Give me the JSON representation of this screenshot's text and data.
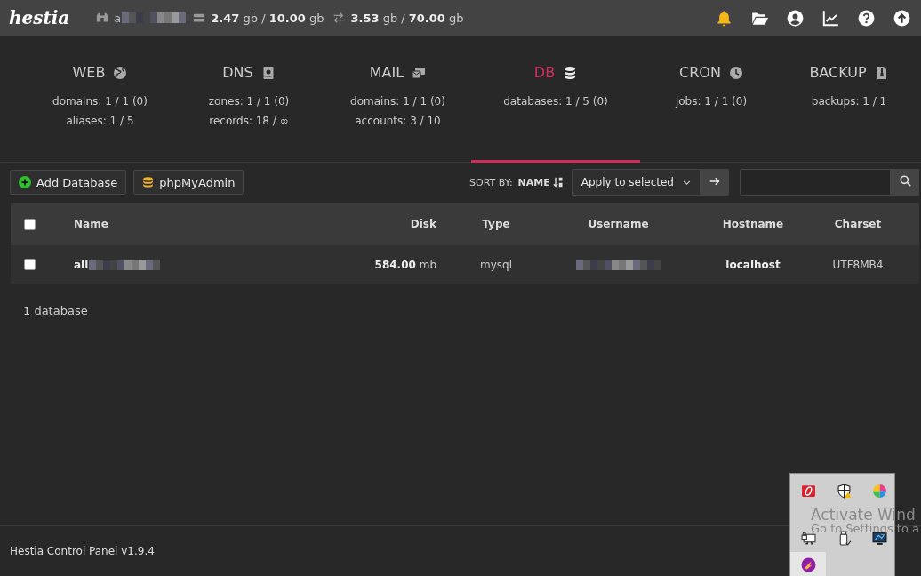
{
  "top_bar": {
    "logo": "hestia",
    "user": "a",
    "disk": "**2.47** gb / **10.00** gb",
    "bandwidth": "**3.53** gb / **70.00** gb",
    "icons": [
      {
        "kind": "bell"
      },
      {
        "kind": "folder"
      },
      {
        "kind": "user"
      },
      {
        "kind": "chart"
      },
      {
        "kind": "help"
      },
      {
        "kind": "update"
      }
    ]
  },
  "nav": [
    {
      "label": "WEB",
      "kind": "globe",
      "selected": false,
      "stats": [
        "domains: 1 / 1 (0)",
        "aliases: 1 / 5"
      ]
    },
    {
      "label": "DNS",
      "kind": "book",
      "selected": false,
      "stats": [
        "zones: 1 / 1 (0)",
        "records: 18 / ∞"
      ]
    },
    {
      "label": "MAIL",
      "kind": "mail",
      "selected": false,
      "stats": [
        "domains: 1 / 1 (0)",
        "accounts: 3 / 10"
      ]
    },
    {
      "label": "DB",
      "kind": "database",
      "selected": true,
      "stats": [
        "databases: 1 / 5 (0)"
      ]
    },
    {
      "label": "CRON",
      "kind": "clock",
      "selected": false,
      "stats": [
        "jobs: 1 / 1 (0)"
      ]
    },
    {
      "label": "BACKUP",
      "kind": "file",
      "selected": false,
      "stats": [
        "backups: 1 / 1"
      ]
    }
  ],
  "toolbar": {
    "buttons": [
      {
        "label": "Add Database",
        "kind": "add"
      },
      {
        "label": "phpMyAdmin",
        "kind": "database"
      }
    ],
    "sort_label": "SORT BY:",
    "sort_value": "NAME",
    "bulk_action": "Apply to selected"
  },
  "table": {
    "select_all": {
      "checked": false
    },
    "columns": [
      "Name",
      "Disk",
      "Type",
      "Username",
      "Hostname",
      "Charset"
    ],
    "rows": [
      {
        "checked": false,
        "name": "all",
        "disk": "**584.00** mb",
        "type": "mysql",
        "hostname": "localhost",
        "charset": "UTF8MB4"
      }
    ]
  },
  "summary": "1 database",
  "footer": "Hestia Control Panel v1.9.4",
  "tray": {
    "icons": [
      {
        "kind": "red-app",
        "selected": false
      },
      {
        "kind": "shield",
        "selected": false
      },
      {
        "kind": "color-wheel",
        "selected": false
      },
      {
        "kind": "network",
        "selected": false
      },
      {
        "kind": "usb",
        "selected": false
      },
      {
        "kind": "monitor",
        "selected": false
      },
      {
        "kind": "purple-app",
        "selected": true
      }
    ]
  },
  "activation": [
    "Activate Wind",
    "Go to Settings to a"
  ]
}
